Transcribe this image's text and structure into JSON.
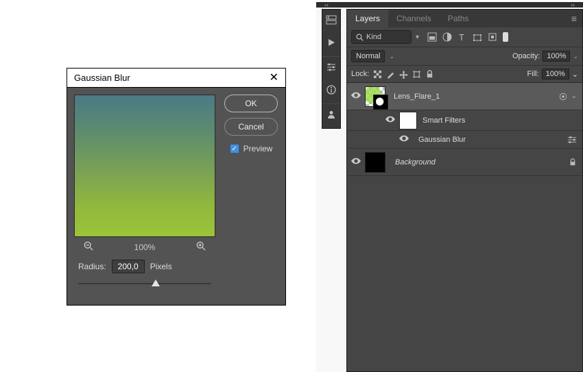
{
  "dialog": {
    "title": "Gaussian Blur",
    "ok_label": "OK",
    "cancel_label": "Cancel",
    "preview_label": "Preview",
    "preview_checked": true,
    "zoom_percent": "100%",
    "radius_label": "Radius:",
    "radius_value": "200,0",
    "radius_unit": "Pixels"
  },
  "panel": {
    "collapse_left": "‹‹",
    "collapse_right": "››",
    "tabs": {
      "layers": "Layers",
      "channels": "Channels",
      "paths": "Paths"
    },
    "filter_kind": "Kind",
    "blend_mode": "Normal",
    "opacity_label": "Opacity:",
    "opacity_value": "100%",
    "lock_label": "Lock:",
    "fill_label": "Fill:",
    "fill_value": "100%",
    "layers": {
      "lens_flare": "Lens_Flare_1",
      "smart_filters": "Smart Filters",
      "gaussian_blur": "Gaussian Blur",
      "background": "Background"
    }
  }
}
